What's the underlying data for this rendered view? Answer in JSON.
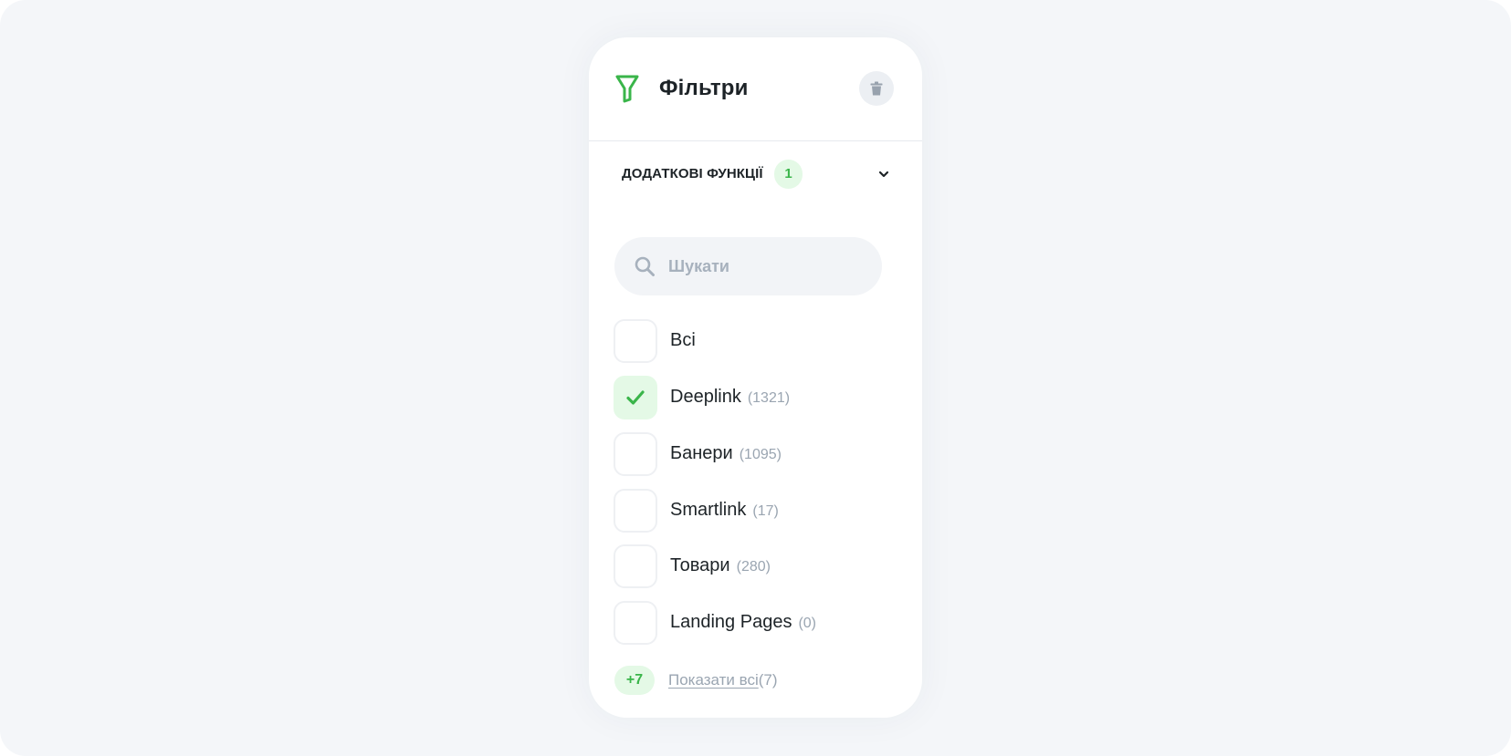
{
  "header": {
    "title": "Фільтри",
    "accent_color": "#3ab54a"
  },
  "section": {
    "title": "ДОДАТКОВІ ФУНКЦІЇ",
    "badge": "1"
  },
  "search": {
    "placeholder": "Шукати",
    "value": ""
  },
  "options": [
    {
      "label": "Всі",
      "count": "",
      "checked": false
    },
    {
      "label": "Deeplink",
      "count": "(1321)",
      "checked": true
    },
    {
      "label": "Банери",
      "count": "(1095)",
      "checked": false
    },
    {
      "label": "Smartlink",
      "count": "(17)",
      "checked": false
    },
    {
      "label": "Товари",
      "count": "(280)",
      "checked": false
    },
    {
      "label": "Landing Pages",
      "count": "(0)",
      "checked": false
    }
  ],
  "more": {
    "badge": "+7",
    "link_label": "Показати всі",
    "count": "(7)"
  },
  "icons": {
    "filter": "filter-icon",
    "trash": "trash-icon",
    "chevron": "chevron-down-icon",
    "search": "search-icon",
    "check": "check-icon"
  }
}
